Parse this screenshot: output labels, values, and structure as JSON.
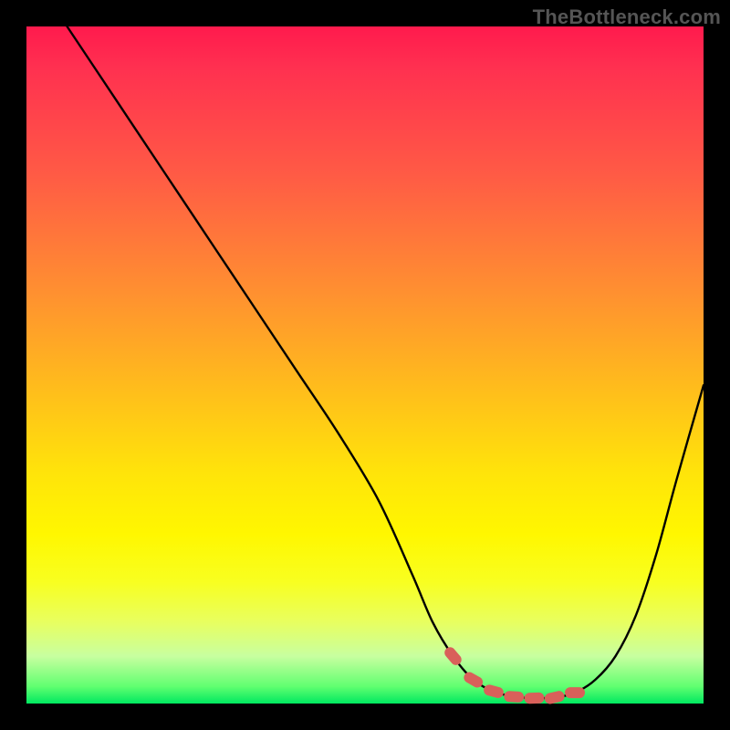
{
  "watermark": "TheBottleneck.com",
  "chart_data": {
    "type": "line",
    "title": "",
    "xlabel": "",
    "ylabel": "",
    "xlim": [
      0,
      100
    ],
    "ylim": [
      0,
      100
    ],
    "series": [
      {
        "name": "curve",
        "x": [
          6,
          10,
          16,
          22,
          28,
          34,
          40,
          46,
          52,
          57,
          60,
          63,
          66,
          69,
          72,
          75,
          78,
          81,
          84,
          87,
          90,
          93,
          96,
          100
        ],
        "y": [
          100,
          94,
          85,
          76,
          67,
          58,
          49,
          40,
          30,
          19,
          12,
          7,
          3.5,
          1.8,
          1.0,
          0.8,
          0.9,
          1.6,
          3.5,
          7,
          13,
          22,
          33,
          47
        ]
      }
    ],
    "highlight_band": {
      "name": "plateau-markers",
      "x": [
        63,
        66,
        69,
        72,
        75,
        78,
        81
      ],
      "y": [
        7,
        3.5,
        1.8,
        1.0,
        0.8,
        0.9,
        1.6
      ]
    },
    "colors": {
      "curve": "#000000",
      "markers": "#d9605a",
      "gradient_top": "#ff1a4d",
      "gradient_bottom": "#00e860"
    }
  }
}
